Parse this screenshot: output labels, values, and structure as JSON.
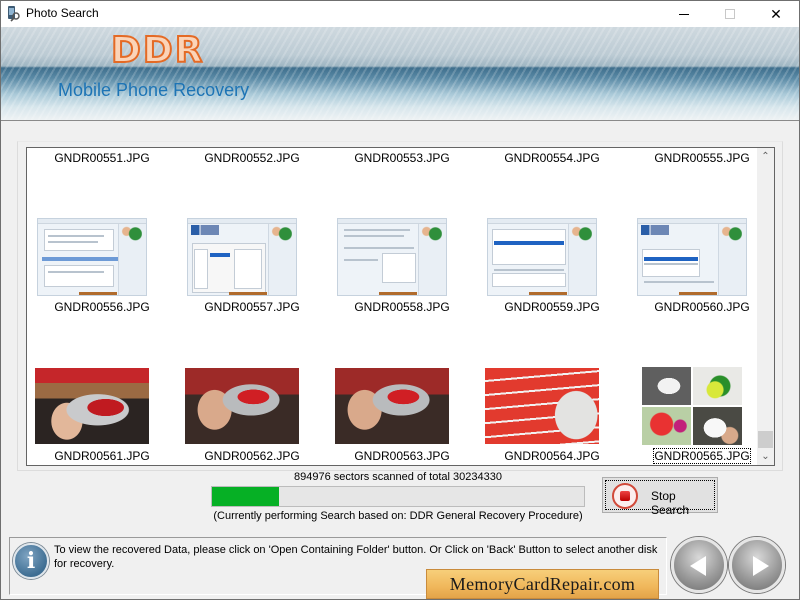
{
  "window": {
    "title": "Photo Search",
    "minimize_label": "",
    "maximize_label": "",
    "close_label": "✕"
  },
  "banner": {
    "logo": "DDR",
    "subtitle": "Mobile Phone Recovery"
  },
  "gallery": {
    "items": [
      {
        "name": "GNDR00551.JPG",
        "thumb": "hidden-above"
      },
      {
        "name": "GNDR00552.JPG",
        "thumb": "hidden-above"
      },
      {
        "name": "GNDR00553.JPG",
        "thumb": "hidden-above"
      },
      {
        "name": "GNDR00554.JPG",
        "thumb": "hidden-above"
      },
      {
        "name": "GNDR00555.JPG",
        "thumb": "hidden-above"
      },
      {
        "name": "GNDR00556.JPG",
        "thumb": "software-screenshot"
      },
      {
        "name": "GNDR00557.JPG",
        "thumb": "software-screenshot-dialog"
      },
      {
        "name": "GNDR00558.JPG",
        "thumb": "software-screenshot-popup"
      },
      {
        "name": "GNDR00559.JPG",
        "thumb": "software-screenshot-list"
      },
      {
        "name": "GNDR00560.JPG",
        "thumb": "software-screenshot-table"
      },
      {
        "name": "GNDR00561.JPG",
        "thumb": "barcode-scanner-photo"
      },
      {
        "name": "GNDR00562.JPG",
        "thumb": "barcode-scanner-photo"
      },
      {
        "name": "GNDR00563.JPG",
        "thumb": "barcode-scanner-photo"
      },
      {
        "name": "GNDR00564.JPG",
        "thumb": "scanner-on-boxes-photo"
      },
      {
        "name": "GNDR00565.JPG",
        "thumb": "craft-steps-photo",
        "selected": true
      }
    ],
    "scroll_position": 0.92
  },
  "progress": {
    "sectors_scanned": 894976,
    "sectors_total": 30234330,
    "status_text": "894976 sectors scanned of total 30234330",
    "fill_fraction": 0.18,
    "fill_color": "#06b025",
    "procedure_text": "(Currently performing Search based on:  DDR General Recovery Procedure)"
  },
  "stop_button": {
    "label": "Stop Search",
    "icon": "stop-icon"
  },
  "info": {
    "icon": "info-icon",
    "text": "To view the recovered Data, please click on 'Open Containing Folder' button. Or Click on 'Back' Button to select another disk for recovery."
  },
  "brand": {
    "text": "MemoryCardRepair.com"
  },
  "nav": {
    "back_icon": "back-arrow-icon",
    "next_icon": "next-arrow-icon"
  }
}
